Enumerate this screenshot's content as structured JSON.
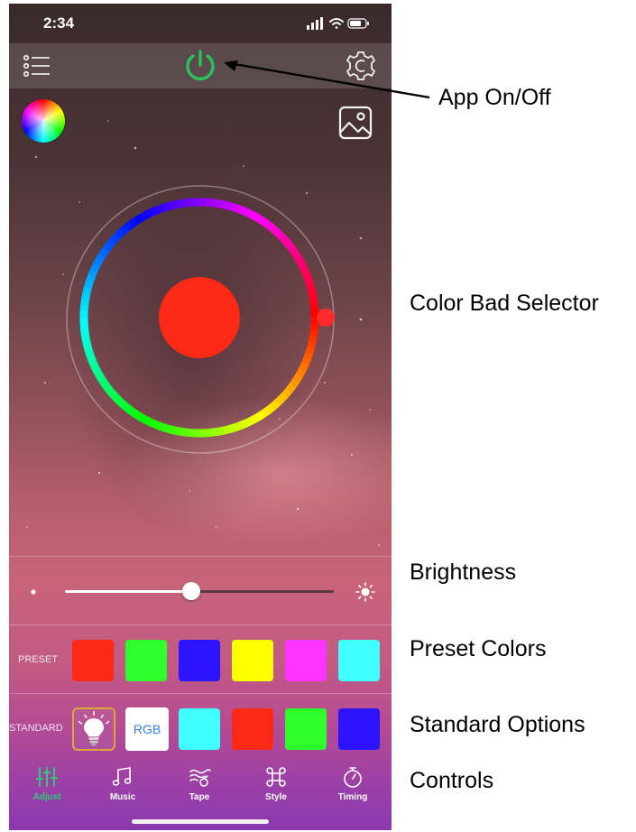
{
  "status_bar": {
    "time": "2:34"
  },
  "top_bar": {
    "menu_icon": "list-icon",
    "power_icon": "power-icon",
    "settings_icon": "gear-icon",
    "power_color": "#27c25c"
  },
  "toolbar": {
    "color_wheel_icon": "color-wheel-icon",
    "image_icon": "image-icon"
  },
  "color_picker": {
    "selected_color": "#ff2a16",
    "marker_position_deg": 90
  },
  "brightness": {
    "level": 0.47
  },
  "preset": {
    "label": "PRESET",
    "colors": [
      "#ff2a16",
      "#2cff2c",
      "#2d14ff",
      "#ffff00",
      "#ff33ff",
      "#40ffff"
    ]
  },
  "standard": {
    "label": "STANDARD",
    "bulb_icon": "bulb-icon",
    "rgb_label": "RGB",
    "colors": [
      "#40ffff",
      "#ff2a16",
      "#2cff2c",
      "#2d14ff"
    ]
  },
  "tabs": [
    {
      "label": "Adjust",
      "icon": "sliders-icon",
      "active": true
    },
    {
      "label": "Music",
      "icon": "music-note-icon",
      "active": false
    },
    {
      "label": "Tape",
      "icon": "tape-icon",
      "active": false
    },
    {
      "label": "Style",
      "icon": "command-icon",
      "active": false
    },
    {
      "label": "Timing",
      "icon": "timer-icon",
      "active": false
    }
  ],
  "annotations": {
    "app_onoff": "App On/Off",
    "color_selector": "Color Bad Selector",
    "brightness": "Brightness",
    "preset_colors": "Preset Colors",
    "standard_options": "Standard Options",
    "controls": "Controls"
  }
}
